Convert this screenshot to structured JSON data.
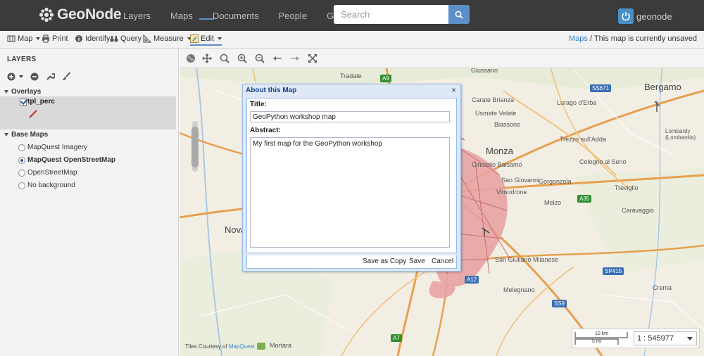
{
  "brand": {
    "name": "GeoNode"
  },
  "nav": {
    "links": [
      "Layers",
      "Maps",
      "Documents",
      "People",
      "Groups"
    ]
  },
  "search": {
    "placeholder": "Search"
  },
  "user": {
    "name": "geonode"
  },
  "toolbar": {
    "map_label": "Map",
    "print_label": "Print",
    "identify_label": "Identify",
    "query_label": "Query",
    "measure_label": "Measure",
    "edit_label": "Edit"
  },
  "breadcrumb": {
    "link": "Maps",
    "separator": "/",
    "text": "This map is currently unsaved"
  },
  "layers_panel": {
    "title": "LAYERS",
    "overlays_header": "Overlays",
    "overlay_layer": {
      "name": "tpl_perc",
      "checked": true
    },
    "base_maps_header": "Base Maps",
    "base_maps": [
      {
        "label": "MapQuest Imagery",
        "selected": false
      },
      {
        "label": "MapQuest OpenStreetMap",
        "selected": true
      },
      {
        "label": "OpenStreetMap",
        "selected": false
      },
      {
        "label": "No background",
        "selected": false
      }
    ]
  },
  "map": {
    "labels": [
      "Tradate",
      "Giussano",
      "Carate Brianza",
      "Lurago d'Erba",
      "Bergamo",
      "Biassono",
      "Usmate Velate",
      "Monza",
      "Trezzo sull'Adda",
      "Cologno al Serio",
      "Cinisello Balsamo",
      "San Giovanni",
      "Gorgonzola",
      "Vimodrone",
      "Melzo",
      "Treviglio",
      "Caravaggio",
      "San Giuliano Milanese",
      "Melegnano",
      "Crema",
      "Mortara",
      "Nova",
      "Lombardy (Lombardia)"
    ],
    "shields": [
      "A9",
      "SS671",
      "A35",
      "SP415",
      "SS9",
      "A7",
      "A12"
    ],
    "attribution_prefix": "Tiles Courtesy of",
    "attribution_link": "MapQuest",
    "scale_km": "10 km",
    "scale_mi": "5 mi",
    "scale_value": "1 : 545977"
  },
  "dialog": {
    "title": "About this Map",
    "title_label": "Title:",
    "title_value": "GeoPython workshop map",
    "abstract_label": "Abstract:",
    "abstract_value": "My first map for the GeoPython workshop",
    "buttons": {
      "save_as_copy": "Save as Copy",
      "save": "Save",
      "cancel": "Cancel"
    }
  },
  "colors": {
    "navbar": "#3b3b3b",
    "accent": "#5b8fc7",
    "dialog_header": "#15428b",
    "urban_area": "#e7a3a3",
    "road": "#e6a04e"
  }
}
